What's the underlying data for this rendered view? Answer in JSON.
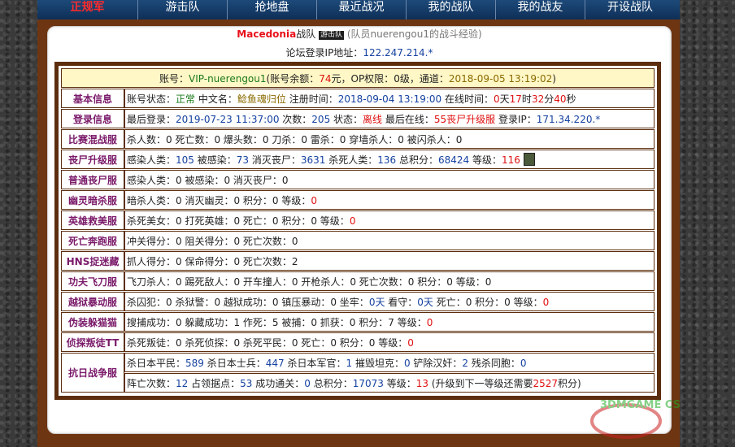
{
  "nav": {
    "items": [
      "正规军",
      "游击队",
      "抢地盘",
      "最近战况",
      "我的战队",
      "我的战友",
      "开设战队"
    ]
  },
  "title": {
    "team": "Macedonia",
    "suffix": "战队",
    "tag": "游击队",
    "desc": "(队员nuerengou1的战斗经验)"
  },
  "ip": {
    "label": "论坛登录IP地址：",
    "value": "122.247.214.*"
  },
  "account": {
    "p1": "账号：",
    "name": "VIP-nuerengou1",
    "p2": "(账号余额：",
    "balance": "74",
    "p3": "元，OP权限：",
    "op": "0",
    "p4": "级，通道：",
    "time": "2018-09-05 13:19:02",
    "p5": ")"
  },
  "rows": [
    {
      "label": "基本信息",
      "parts": [
        [
          "账号状态：",
          ""
        ],
        [
          "正常",
          "green"
        ],
        [
          " 中文名：",
          ""
        ],
        [
          "鲶鱼魂归位",
          "olive"
        ],
        [
          " 注册时间：",
          ""
        ],
        [
          "2018-09-04 13:19:00",
          "blue"
        ],
        [
          " 在线时间：",
          ""
        ],
        [
          "0",
          "red"
        ],
        [
          "天",
          ""
        ],
        [
          "17",
          "red"
        ],
        [
          "时",
          ""
        ],
        [
          "32",
          "red"
        ],
        [
          "分",
          ""
        ],
        [
          "40",
          "red"
        ],
        [
          "秒",
          ""
        ]
      ]
    },
    {
      "label": "登录信息",
      "parts": [
        [
          "最后登录：",
          ""
        ],
        [
          "2019-07-23 11:37:00",
          "blue"
        ],
        [
          " 次数：",
          ""
        ],
        [
          "205",
          "blue"
        ],
        [
          " 状态：",
          ""
        ],
        [
          "离线",
          "red"
        ],
        [
          " 最后在线：",
          ""
        ],
        [
          "55丧尸升级服",
          "red"
        ],
        [
          " 登录IP：",
          ""
        ],
        [
          "171.34.220.*",
          "blue"
        ]
      ]
    },
    {
      "label": "比赛混战服",
      "parts": [
        [
          "杀人数：0 死亡数：0 爆头数：0 刀杀：0 雷杀：0 穿墙杀人：0 被闪杀人：0",
          ""
        ]
      ]
    },
    {
      "label": "丧尸升级服",
      "parts": [
        [
          "感染人类：",
          ""
        ],
        [
          "105",
          "blue"
        ],
        [
          " 被感染：",
          ""
        ],
        [
          "73",
          "blue"
        ],
        [
          " 消灭丧尸：",
          ""
        ],
        [
          "3631",
          "blue"
        ],
        [
          " 杀死人类：",
          ""
        ],
        [
          "136",
          "blue"
        ],
        [
          " 总积分：",
          ""
        ],
        [
          "68424",
          "blue"
        ],
        [
          " 等级：",
          ""
        ],
        [
          "116",
          "red"
        ]
      ],
      "icon": "rank-badge-icon"
    },
    {
      "label": "普通丧尸服",
      "parts": [
        [
          "感染人类：0 被感染：0 消灭丧尸：0",
          ""
        ]
      ]
    },
    {
      "label": "幽灵暗杀服",
      "parts": [
        [
          "暗杀人类：0 消灭幽灵：0 积分：0 等级：",
          ""
        ],
        [
          "0",
          "red"
        ]
      ]
    },
    {
      "label": "英雄救美服",
      "parts": [
        [
          "杀死美女：0 打死英雄：0 死亡：0 积分：0 等级：",
          ""
        ],
        [
          "0",
          "red"
        ]
      ]
    },
    {
      "label": "死亡奔跑服",
      "parts": [
        [
          "冲关得分：0 阻关得分：0 死亡次数：0",
          ""
        ]
      ]
    },
    {
      "label": "HNS捉迷藏",
      "parts": [
        [
          "抓人得分：0 保命得分：0 死亡次数：2",
          ""
        ]
      ]
    },
    {
      "label": "功夫飞刀服",
      "parts": [
        [
          "飞刀杀人：0 踢死敌人：0 开车撞人：0 开枪杀人：0 死亡次数：0 积分：0 等级：0",
          ""
        ]
      ]
    },
    {
      "label": "越狱暴动服",
      "parts": [
        [
          "杀囚犯：0 杀狱警：0 越狱成功：0 镇压暴动：0 坐牢：",
          ""
        ],
        [
          "0天",
          "blue"
        ],
        [
          " 看守：",
          ""
        ],
        [
          "0天",
          "blue"
        ],
        [
          " 死亡：0 积分：0 等级：",
          ""
        ],
        [
          "0",
          "red"
        ]
      ]
    },
    {
      "label": "伪装躲猫猫",
      "parts": [
        [
          "搜捕成功：0 躲藏成功：1 作死：5 被捕：0 抓获：0 积分：7 等级：",
          ""
        ],
        [
          "0",
          "red"
        ]
      ]
    },
    {
      "label": "侦探叛徒TT",
      "parts": [
        [
          "杀死叛徒：0 杀死侦探：0 杀死平民：0 死亡：0 积分：0 等级：",
          ""
        ],
        [
          "0",
          "red"
        ]
      ]
    }
  ],
  "last": {
    "label": "抗日战争服",
    "line1": [
      [
        "杀日本平民：",
        ""
      ],
      [
        "589",
        "blue"
      ],
      [
        " 杀日本士兵：",
        ""
      ],
      [
        "447",
        "blue"
      ],
      [
        " 杀日本军官：",
        ""
      ],
      [
        "1",
        "blue"
      ],
      [
        " 摧毁坦克：",
        ""
      ],
      [
        "0",
        "blue"
      ],
      [
        " 铲除汉奸：",
        ""
      ],
      [
        "2",
        "blue"
      ],
      [
        " 残杀同胞：",
        ""
      ],
      [
        "0",
        "blue"
      ]
    ],
    "line2": [
      [
        "阵亡次数：",
        ""
      ],
      [
        "12",
        "blue"
      ],
      [
        " 占领据点：",
        ""
      ],
      [
        "53",
        "blue"
      ],
      [
        " 成功通关：",
        ""
      ],
      [
        "0",
        "blue"
      ],
      [
        " 总积分：",
        ""
      ],
      [
        "17073",
        "blue"
      ],
      [
        " 等级：",
        ""
      ],
      [
        "13",
        "red"
      ],
      [
        " (升级到下一等级还需要",
        ""
      ],
      [
        "2527",
        "red"
      ],
      [
        "积分)",
        ""
      ]
    ]
  },
  "watermark": "3DMGAME CS"
}
